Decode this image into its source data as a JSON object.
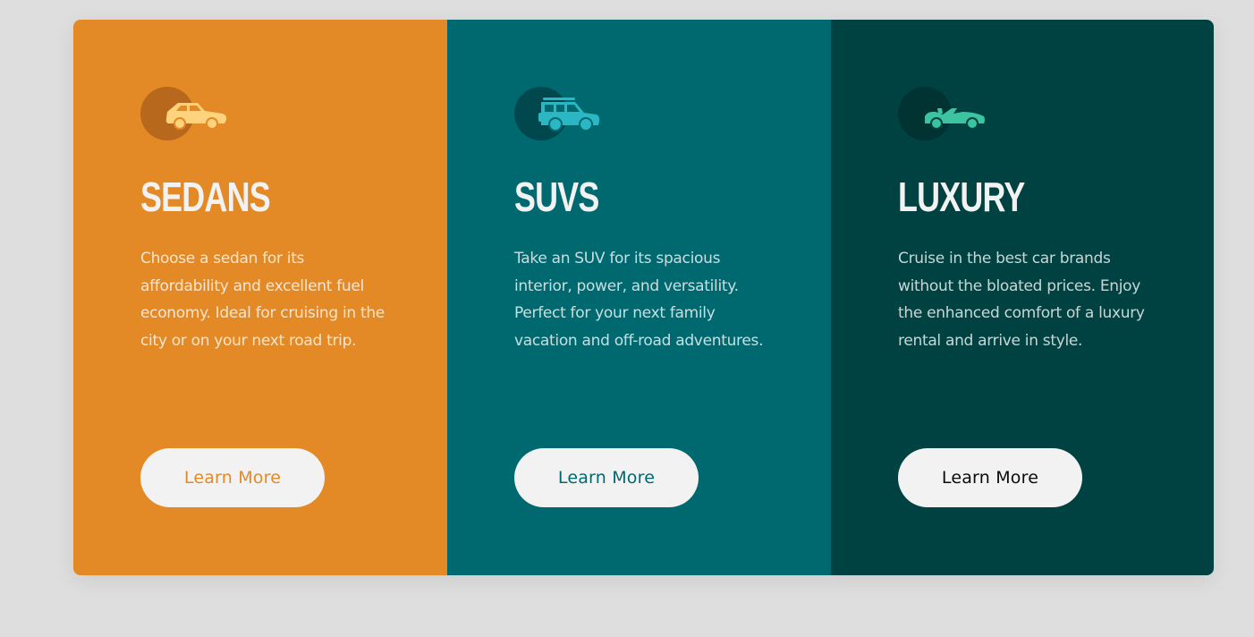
{
  "colors": {
    "background": "#dedede",
    "sedans": "#e38926",
    "suvs": "#006970",
    "luxury": "#004241",
    "button_bg": "#f2f2f2",
    "heading": "#f2f2f2"
  },
  "cards": [
    {
      "icon": "sedan-car-icon",
      "title": "SEDANS",
      "description": "Choose a sedan for its affordability and excellent fuel economy. Ideal for cruising in the city or on your next road trip.",
      "button_label": "Learn More"
    },
    {
      "icon": "suv-car-icon",
      "title": "SUVS",
      "description": "Take an SUV for its spacious interior, power, and versatility. Perfect for your next family vacation and off-road adventures.",
      "button_label": "Learn More"
    },
    {
      "icon": "luxury-convertible-icon",
      "title": "LUXURY",
      "description": "Cruise in the best car brands without the bloated prices. Enjoy the enhanced comfort of a luxury rental and arrive in style.",
      "button_label": "Learn More"
    }
  ]
}
